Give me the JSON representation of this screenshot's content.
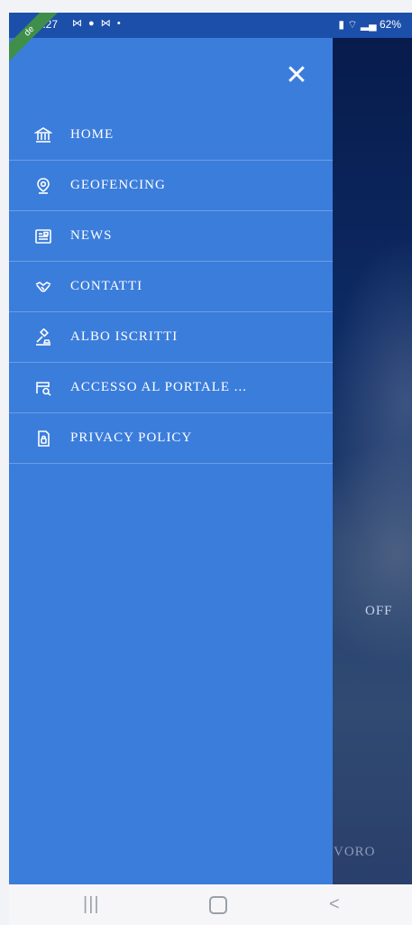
{
  "status_bar": {
    "time": "17:27",
    "notification_icons": "⋈ ● ⋈ •",
    "right": "62%"
  },
  "debug_ribbon": "de",
  "drawer": {
    "close_glyph": "✕",
    "items": [
      {
        "label": "HOME",
        "icon": "bank-icon"
      },
      {
        "label": "GEOFENCING",
        "icon": "location-pin-icon"
      },
      {
        "label": "NEWS",
        "icon": "newspaper-icon"
      },
      {
        "label": "CONTATTI",
        "icon": "handshake-icon"
      },
      {
        "label": "ALBO ISCRITTI",
        "icon": "gavel-icon"
      },
      {
        "label": "ACCESSO AL PORTALE ...",
        "icon": "portal-search-icon"
      },
      {
        "label": "PRIVACY POLICY",
        "icon": "document-lock-icon"
      }
    ]
  },
  "background": {
    "text_offe": "OFF",
    "text_voro": "VORO"
  },
  "nav_bar": {
    "recents": "|||",
    "back": "<"
  }
}
